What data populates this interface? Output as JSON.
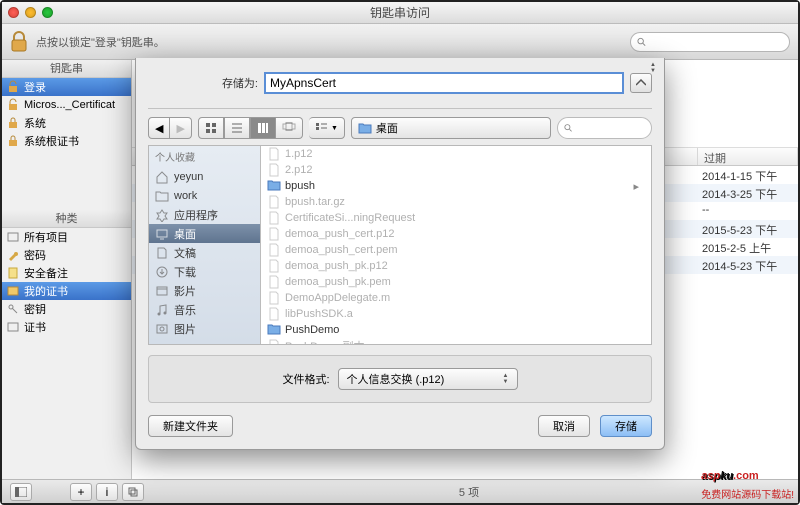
{
  "window_title": "钥匙串访问",
  "lock_hint": "点按以锁定\"登录\"钥匙串。",
  "left": {
    "section1_title": "钥匙串",
    "items1": [
      "登录",
      "Micros..._Certificat",
      "系统",
      "系统根证书"
    ],
    "section2_title": "种类",
    "items2": [
      "所有项目",
      "密码",
      "安全备注",
      "我的证书",
      "密钥",
      "证书"
    ]
  },
  "columns": {
    "expires": "过期"
  },
  "rows": [
    {
      "exp": "2014-1-15 下午"
    },
    {
      "exp": "2014-3-25 下午"
    },
    {
      "exp": "--"
    },
    {
      "exp": "2015-5-23 下午"
    },
    {
      "exp": "2015-2-5 上午"
    },
    {
      "exp": "2014-5-23 下午"
    }
  ],
  "status_count": "5 项",
  "dialog": {
    "save_label": "存储为:",
    "save_value": "MyApnsCert",
    "location_label": "桌面",
    "sidebar_section": "个人收藏",
    "sidebar_items": [
      "yeyun",
      "work",
      "应用程序",
      "桌面",
      "文稿",
      "下载",
      "影片",
      "音乐",
      "图片"
    ],
    "files": [
      "1.p12",
      "2.p12",
      "bpush",
      "bpush.tar.gz",
      "CertificateSi...ningRequest",
      "demoa_push_cert.p12",
      "demoa_push_cert.pem",
      "demoa_push_pk.p12",
      "demoa_push_pk.pem",
      "DemoAppDelegate.m",
      "libPushSDK.a",
      "PushDemo",
      "PushDemo 副本"
    ],
    "format_label": "文件格式:",
    "format_value": "个人信息交换 (.p12)",
    "new_folder": "新建文件夹",
    "cancel": "取消",
    "save": "存储"
  },
  "watermark": {
    "brand": "asp",
    "brand2": "ku",
    "dom": ".com",
    "tag": "免费网站源码下载站!"
  }
}
